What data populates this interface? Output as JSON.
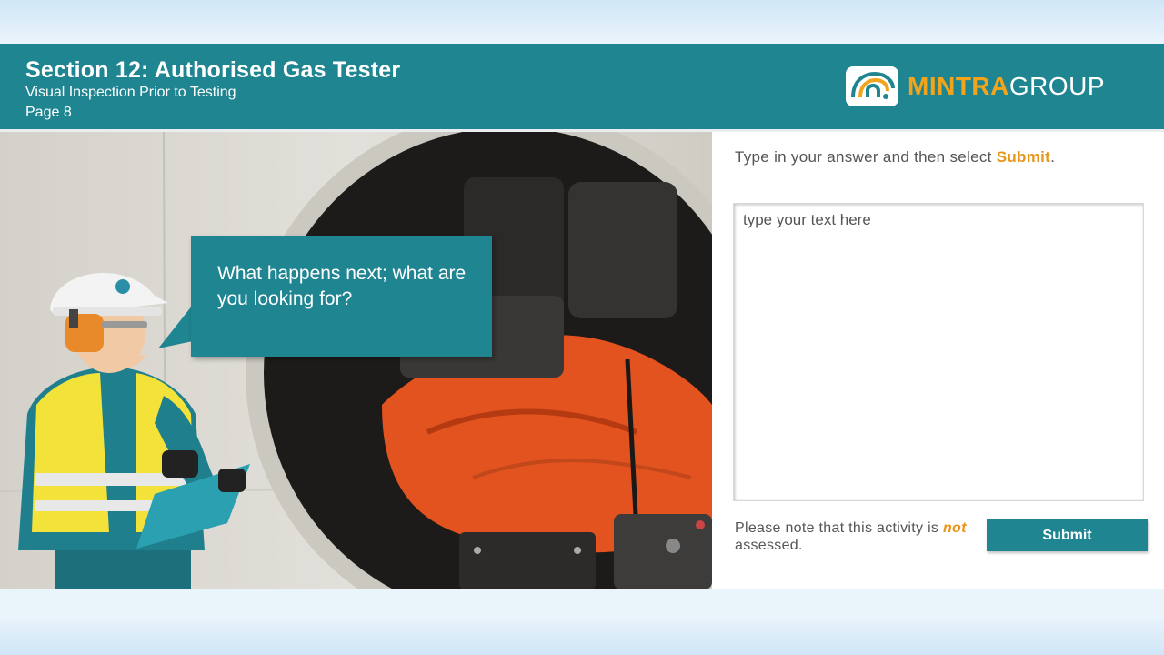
{
  "header": {
    "title": "Section 12: Authorised Gas Tester",
    "subtitle": "Visual Inspection Prior to Testing",
    "page": "Page 8",
    "logo_primary": "MINTRA",
    "logo_secondary": "GROUP"
  },
  "scene": {
    "question": "What happens next; what are you looking for?"
  },
  "activity": {
    "instruction_prefix": "Type in your answer and then select",
    "instruction_highlight": "Submit",
    "instruction_suffix": ".",
    "placeholder": "type your text here",
    "note_prefix": "Please note that this activity is",
    "note_emphasis": "not",
    "note_suffix": "assessed.",
    "submit_label": "Submit"
  },
  "colors": {
    "teal": "#1f8591",
    "accent": "#e8961b",
    "logo_orange": "#f2a51a"
  }
}
